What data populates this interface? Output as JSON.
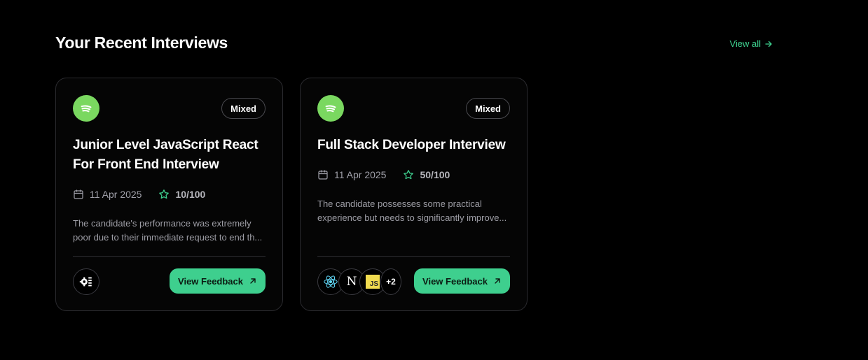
{
  "section": {
    "title": "Your Recent Interviews",
    "view_all_label": "View all"
  },
  "interviews": [
    {
      "company_icon": "spotify-icon",
      "type": "Mixed",
      "title": "Junior Level JavaScript React For Front End Interview",
      "date": "11 Apr 2025",
      "score": "10/100",
      "description_line1": "The candidate's performance was extremely",
      "description_line2": "poor due to their immediate request to end th...",
      "tech_stack": [
        "generic-tech-icon"
      ],
      "button_label": "View Feedback"
    },
    {
      "company_icon": "spotify-icon",
      "type": "Mixed",
      "title": "Full Stack Developer Interview",
      "date": "11 Apr 2025",
      "score": "50/100",
      "description_line1": "The candidate possesses some practical",
      "description_line2": "experience but needs to significantly improve...",
      "tech_stack": [
        "react-icon",
        "nextjs-icon",
        "javascript-icon"
      ],
      "tech_more": "+2",
      "js_label": "JS",
      "next_label": "N",
      "button_label": "View Feedback"
    }
  ],
  "colors": {
    "accent": "#3ecf8e",
    "background": "#000000",
    "logo_bg": "#7ad860",
    "js_yellow": "#f0db4f"
  }
}
